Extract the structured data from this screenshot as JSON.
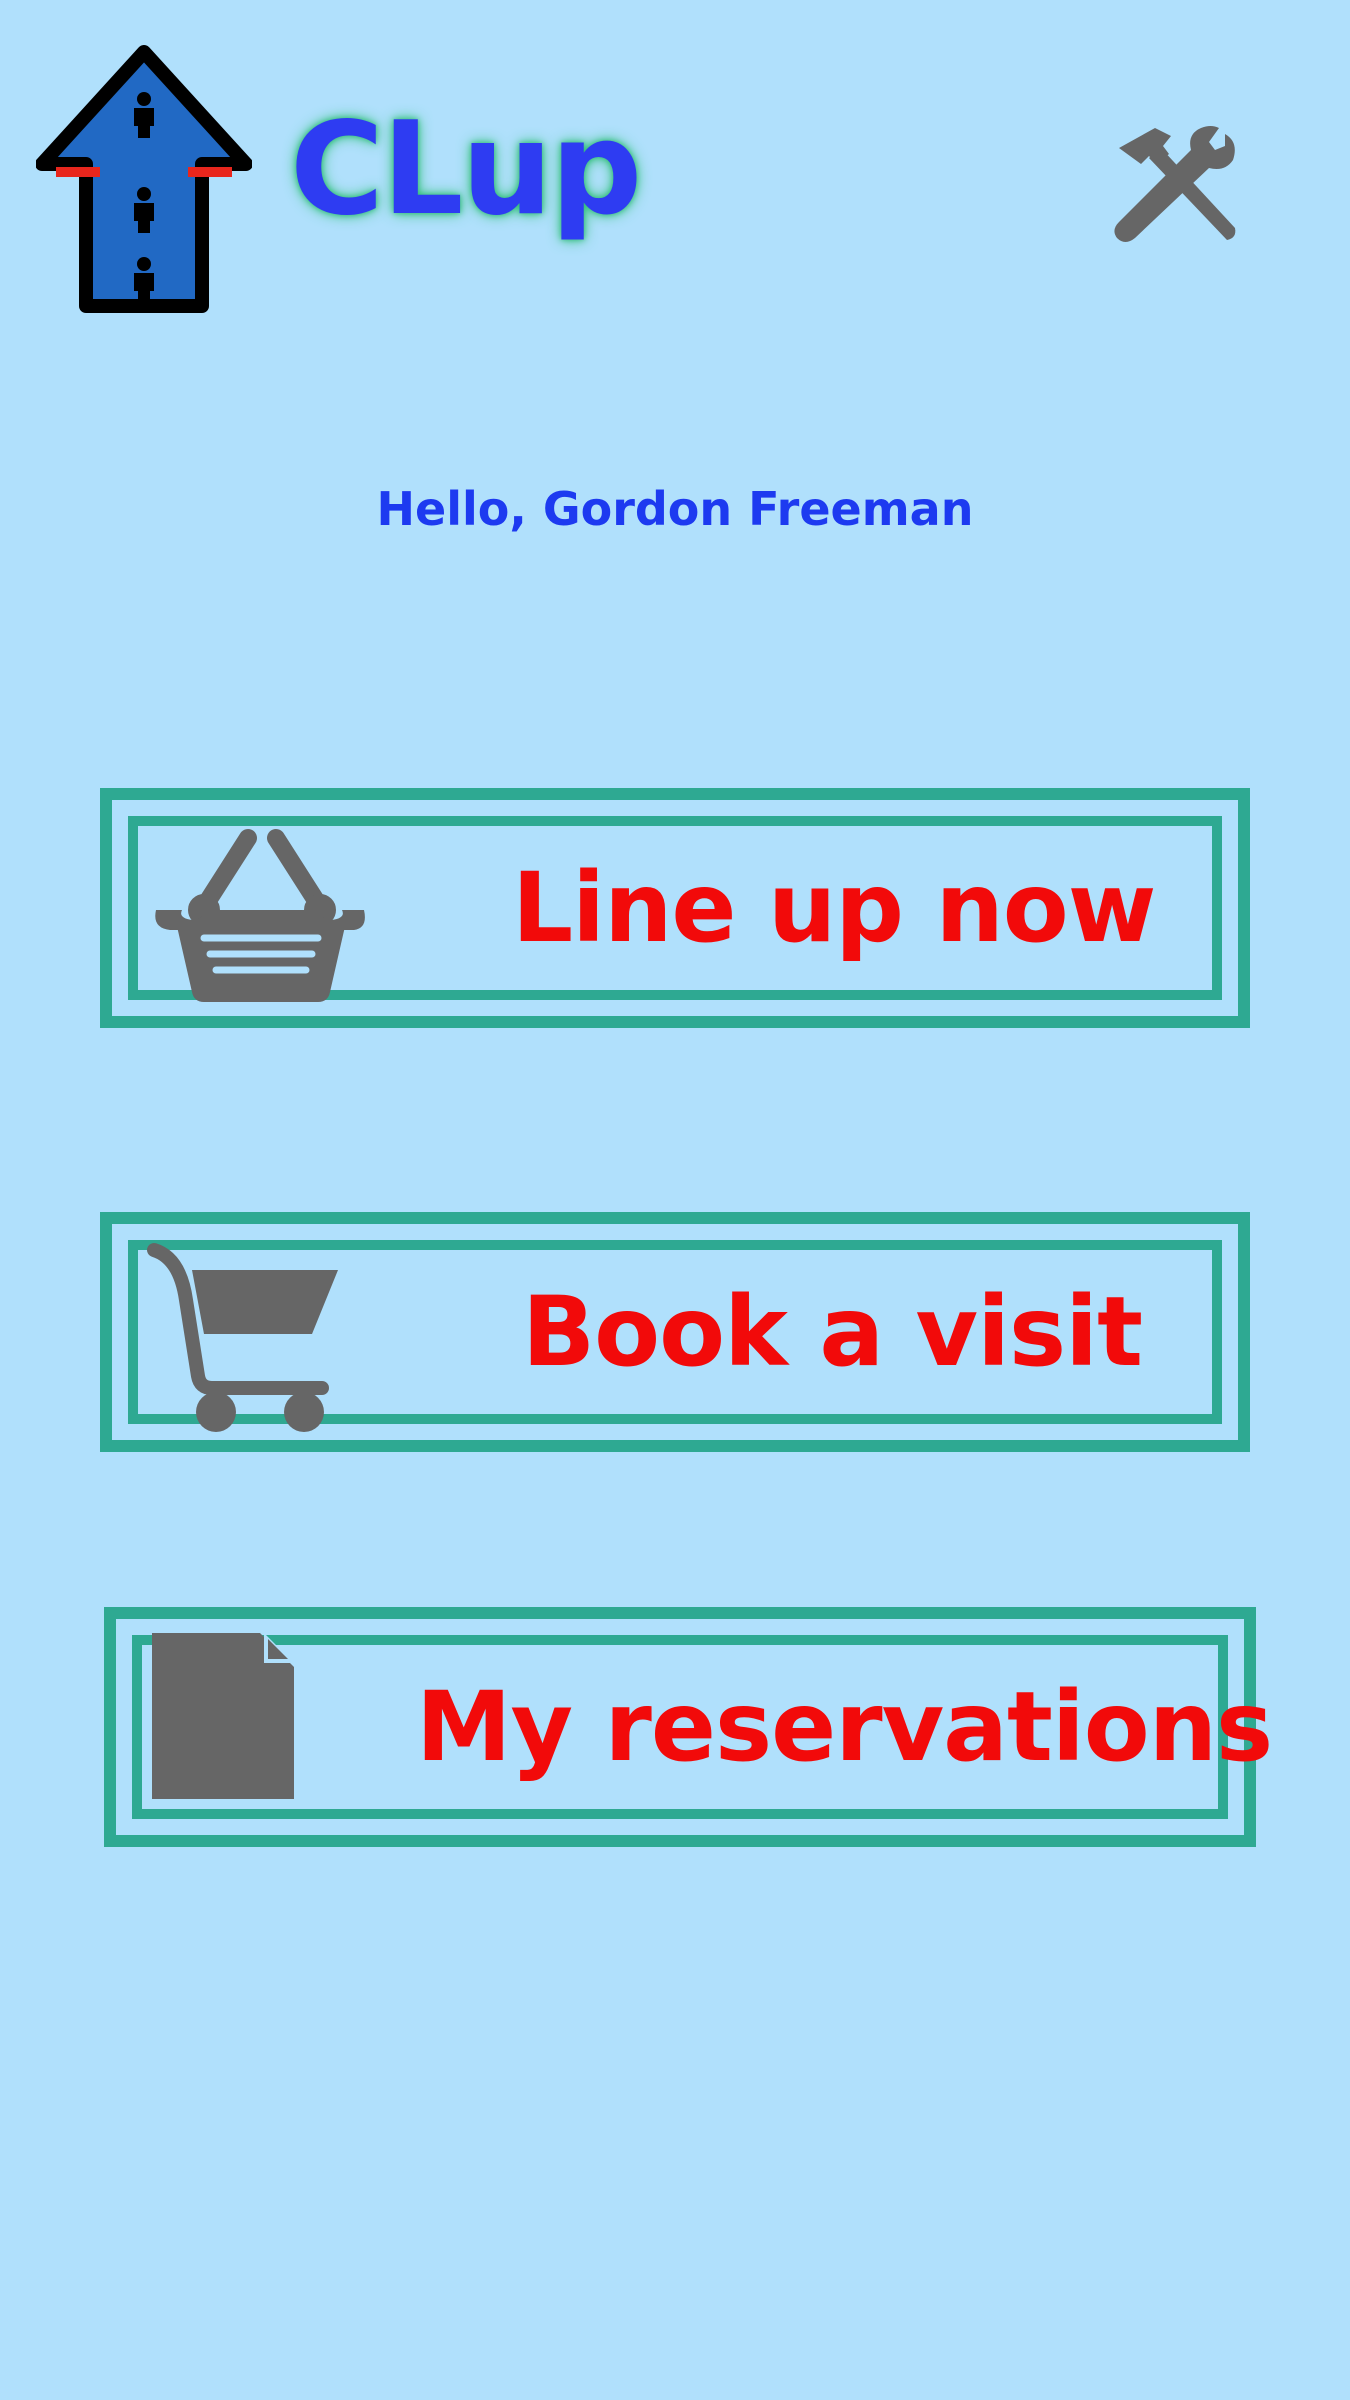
{
  "header": {
    "app_name": "CLup",
    "logo_icon": "up-arrow-queue-icon",
    "settings_icon": "tools-icon"
  },
  "greeting": "Hello, Gordon Freeman",
  "actions": [
    {
      "label": "Line up now",
      "icon": "basket-icon"
    },
    {
      "label": "Book a visit",
      "icon": "cart-icon"
    },
    {
      "label": "My reservations",
      "icon": "document-icon"
    }
  ],
  "colors": {
    "background": "#b0e0fc",
    "title": "#2e3cf2",
    "greeting": "#1d3af0",
    "button_border": "#2ea992",
    "button_text": "#f20a0a",
    "icon_gray": "#666666"
  }
}
